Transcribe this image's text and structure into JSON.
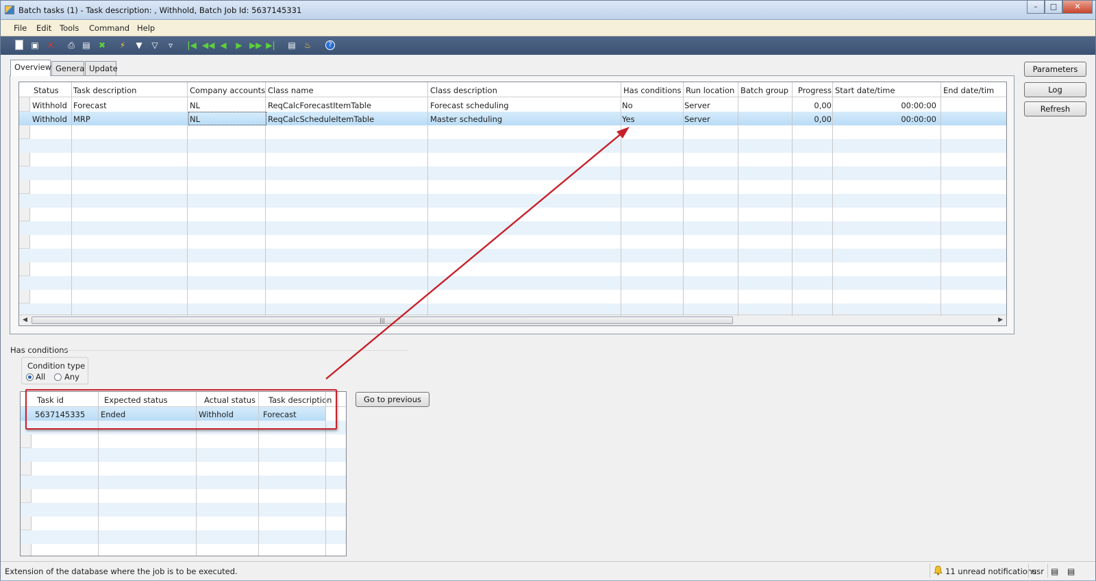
{
  "window": {
    "title": "Batch tasks (1) - Task description: , Withhold, Batch Job Id: 5637145331",
    "minimize": "–",
    "maximize": "□",
    "close": "✕"
  },
  "menu": [
    "File",
    "Edit",
    "Tools",
    "Command",
    "Help"
  ],
  "toolbar_icons": [
    "new-icon",
    "save-icon",
    "delete-icon",
    "print-icon",
    "print-preview-icon",
    "excel-icon",
    "filter-by-selection-icon",
    "filter-by-grid-icon",
    "advanced-filter-icon",
    "filter-icon",
    "first-record-icon",
    "previous-page-icon",
    "previous-record-icon",
    "next-record-icon",
    "next-page-icon",
    "last-record-icon",
    "document-handling-icon",
    "alert-icon",
    "help-icon"
  ],
  "tabs": [
    "Overview",
    "General",
    "Update"
  ],
  "tasks_grid": {
    "columns": [
      "Status",
      "Task description",
      "Company accounts",
      "Class name",
      "Class description",
      "Has conditions",
      "Run location",
      "Batch group",
      "Progress",
      "Start date/time",
      "End date/tim"
    ],
    "rows": [
      [
        "Withhold",
        "Forecast",
        "NL",
        "ReqCalcForecastItemTable",
        "Forecast scheduling",
        "No",
        "Server",
        "",
        "0,00",
        "00:00:00",
        ""
      ],
      [
        "Withhold",
        "MRP",
        "NL",
        "ReqCalcScheduleItemTable",
        "Master scheduling",
        "Yes",
        "Server",
        "",
        "0,00",
        "00:00:00",
        ""
      ]
    ],
    "scroll_grip": "|||"
  },
  "side_buttons": {
    "parameters": "Parameters",
    "log": "Log",
    "refresh": "Refresh"
  },
  "conditions": {
    "section_title": "Has conditions",
    "condition_type_label": "Condition type",
    "option_all": "All",
    "option_any": "Any",
    "selected": "All",
    "columns": [
      "Task id",
      "Expected status",
      "Actual status",
      "Task description"
    ],
    "rows": [
      [
        "5637145335",
        "Ended",
        "Withhold",
        "Forecast"
      ]
    ],
    "go_to_previous": "Go to previous"
  },
  "status_bar": {
    "message": "Extension of the database where the job is to be executed.",
    "notifications": "11 unread notifications",
    "user": "usr"
  },
  "colors": {
    "annotation_red": "#c8202a",
    "selected_row": "#b9dcf6",
    "alt_row": "#e8f2fb"
  }
}
